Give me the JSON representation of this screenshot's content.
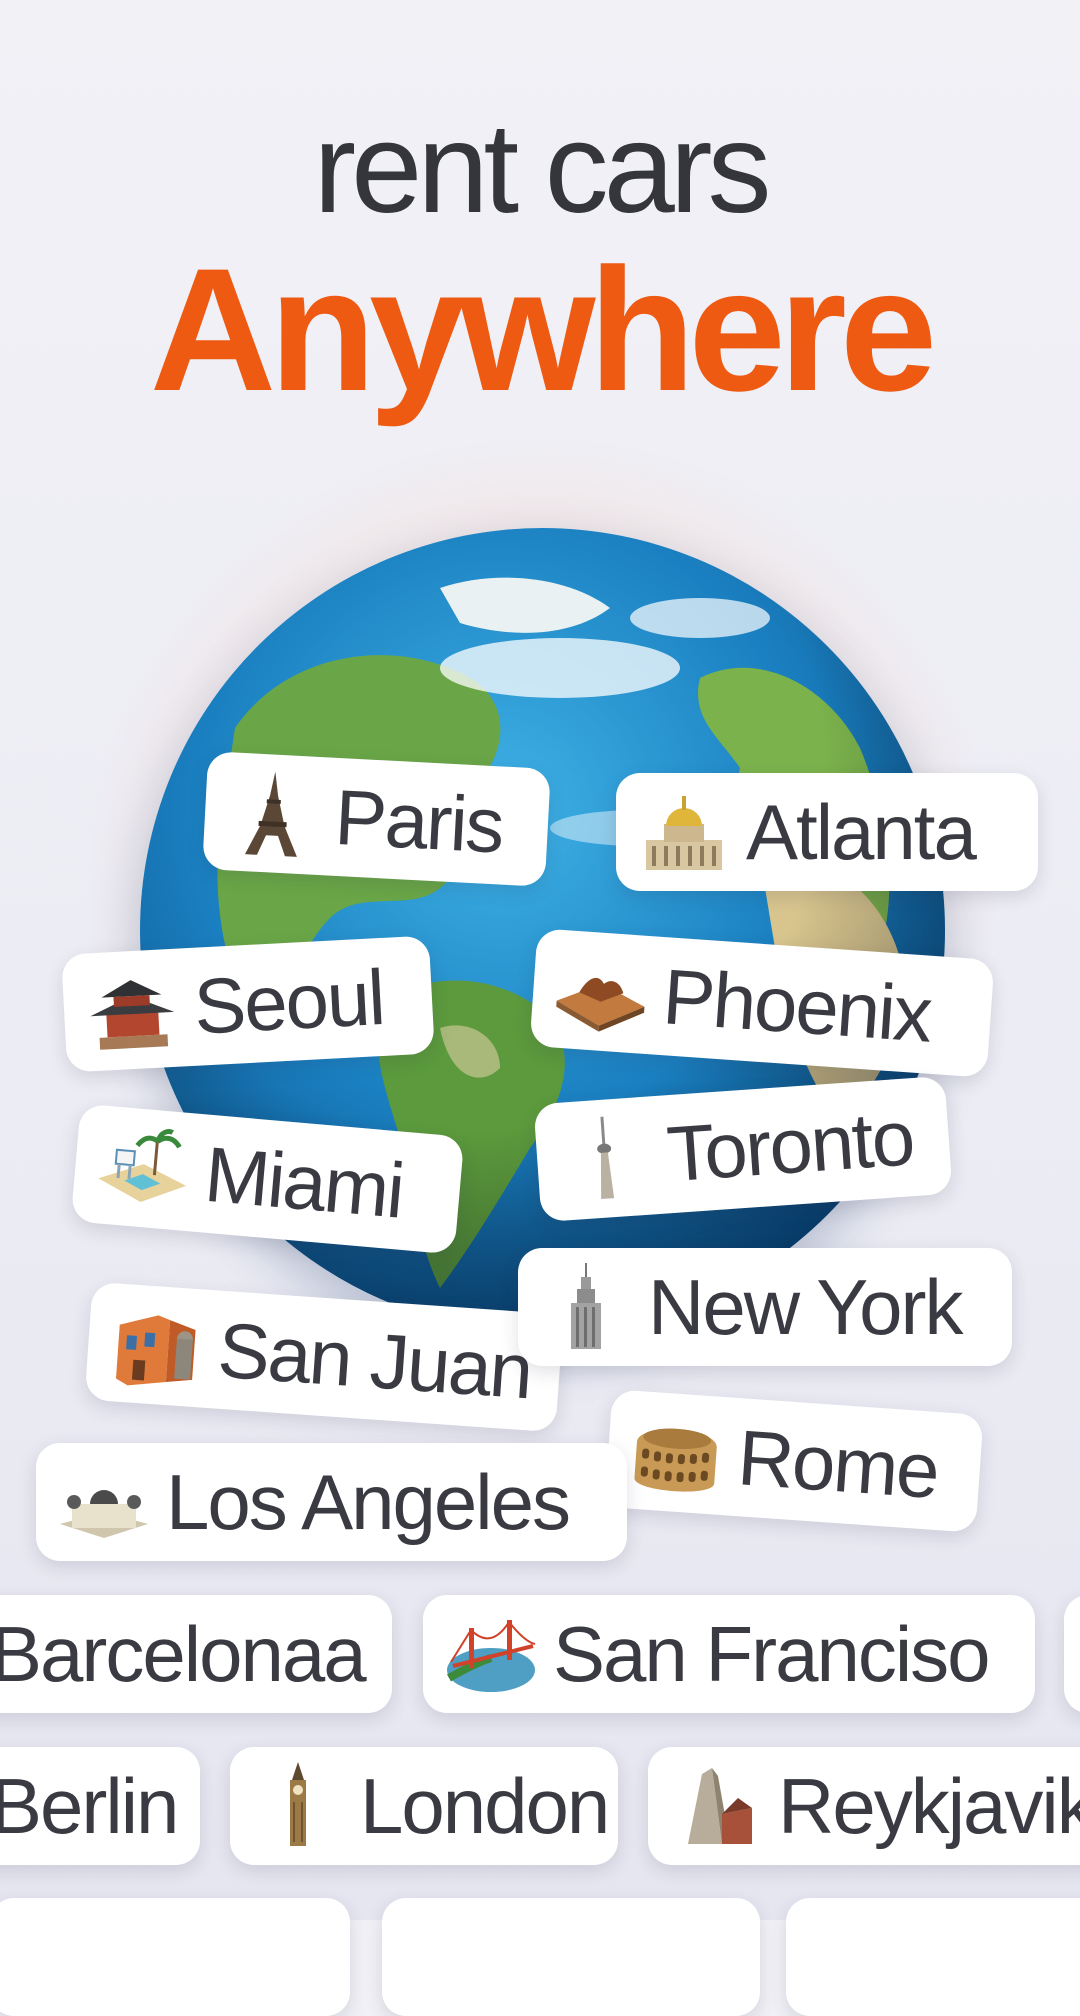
{
  "headline": {
    "line1": "rent cars",
    "line2": "Anywhere"
  },
  "colors": {
    "accent": "#ee5a12",
    "text": "#35353c",
    "chip_bg": "#ffffff",
    "background": "#f0f0f5"
  },
  "globe": {
    "icon": "earth-globe"
  },
  "cities": [
    {
      "label": "Paris",
      "icon": "eiffel-tower-icon"
    },
    {
      "label": "Atlanta",
      "icon": "capitol-building-icon"
    },
    {
      "label": "Seoul",
      "icon": "pagoda-icon"
    },
    {
      "label": "Phoenix",
      "icon": "desert-mesa-icon"
    },
    {
      "label": "Miami",
      "icon": "lifeguard-beach-icon"
    },
    {
      "label": "Toronto",
      "icon": "cn-tower-icon"
    },
    {
      "label": "San Juan",
      "icon": "colonial-house-icon"
    },
    {
      "label": "New York",
      "icon": "empire-state-icon"
    },
    {
      "label": "Rome",
      "icon": "colosseum-icon"
    },
    {
      "label": "Los Angeles",
      "icon": "observatory-icon"
    },
    {
      "label": "Barcelonaa",
      "icon": ""
    },
    {
      "label": "San Franciso",
      "icon": "golden-gate-icon"
    },
    {
      "label": "Berlin",
      "icon": ""
    },
    {
      "label": "London",
      "icon": "big-ben-icon"
    },
    {
      "label": "Reykjavik",
      "icon": "church-icon"
    }
  ]
}
